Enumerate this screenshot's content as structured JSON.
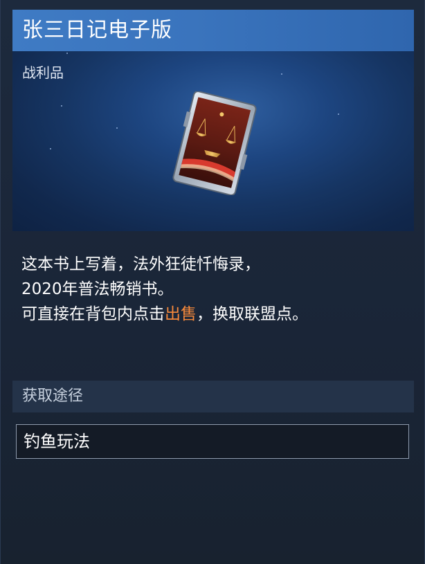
{
  "item": {
    "title": "张三日记电子版",
    "category": "战利品",
    "icon": "law-book-scales-icon"
  },
  "description": {
    "line1": "这本书上写着，法外狂徒忏悔录，",
    "line2": "2020年普法畅销书。",
    "line3_prefix": "可直接在背包内点击",
    "line3_highlight": "出售",
    "line3_suffix": "，换取联盟点。",
    "highlight_color": "#f6893b"
  },
  "acquisition": {
    "header": "获取途径",
    "sources": [
      {
        "label": "钓鱼玩法"
      }
    ]
  },
  "colors": {
    "title_bar": "#3f7bc4",
    "background": "#1b2638",
    "section_header": "#243349"
  }
}
